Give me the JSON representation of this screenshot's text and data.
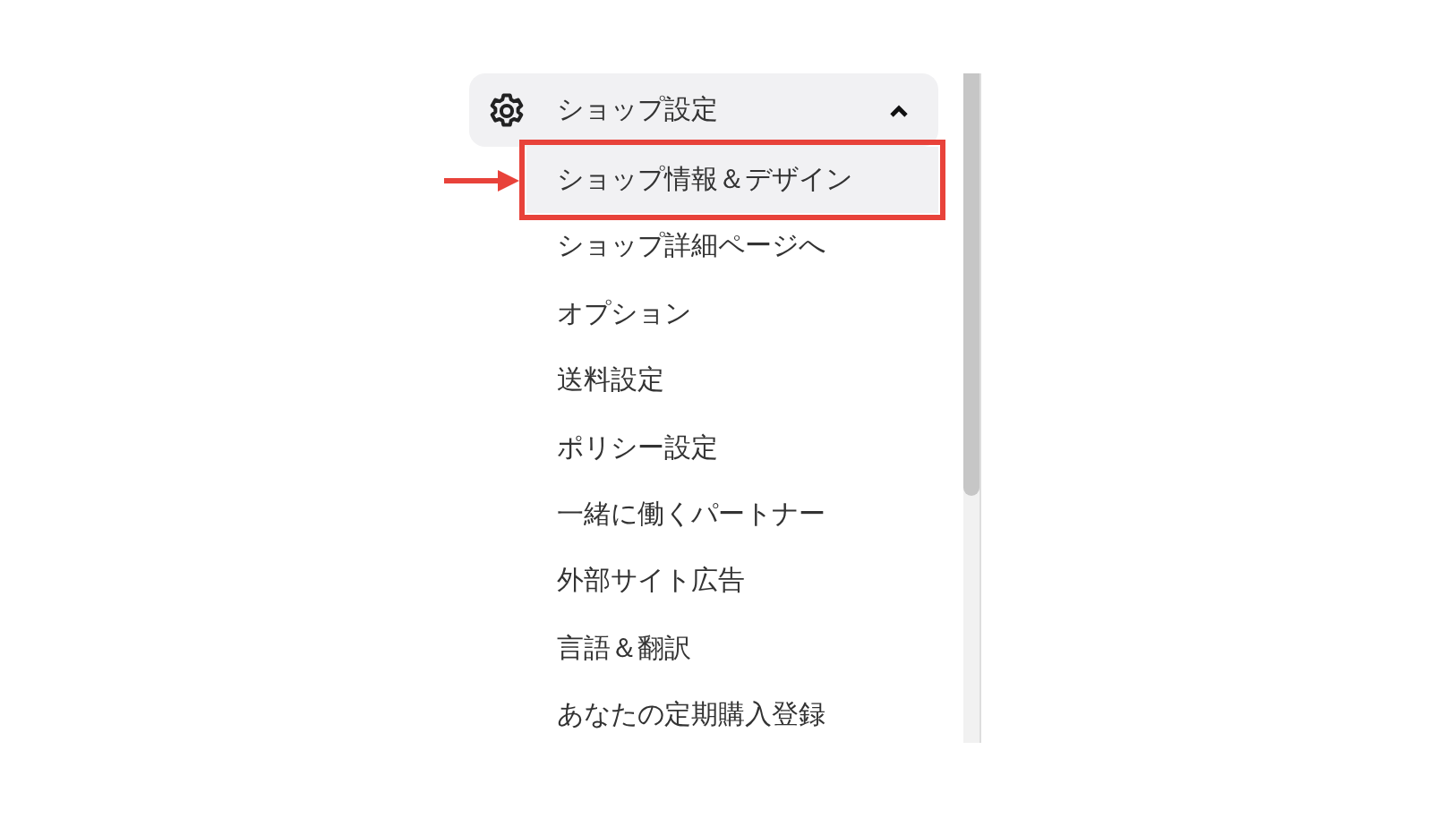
{
  "sidebar": {
    "section": {
      "title": "ショップ設定",
      "expanded": true
    },
    "items": [
      {
        "label": "ショップ情報＆デザイン",
        "selected": true,
        "annotated": true
      },
      {
        "label": "ショップ詳細ページへ",
        "selected": false,
        "annotated": false
      },
      {
        "label": "オプション",
        "selected": false,
        "annotated": false
      },
      {
        "label": "送料設定",
        "selected": false,
        "annotated": false
      },
      {
        "label": "ポリシー設定",
        "selected": false,
        "annotated": false
      },
      {
        "label": "一緒に働くパートナー",
        "selected": false,
        "annotated": false
      },
      {
        "label": "外部サイト広告",
        "selected": false,
        "annotated": false
      },
      {
        "label": "言語＆翻訳",
        "selected": false,
        "annotated": false
      },
      {
        "label": "あなたの定期購入登録",
        "selected": false,
        "annotated": false
      }
    ]
  }
}
